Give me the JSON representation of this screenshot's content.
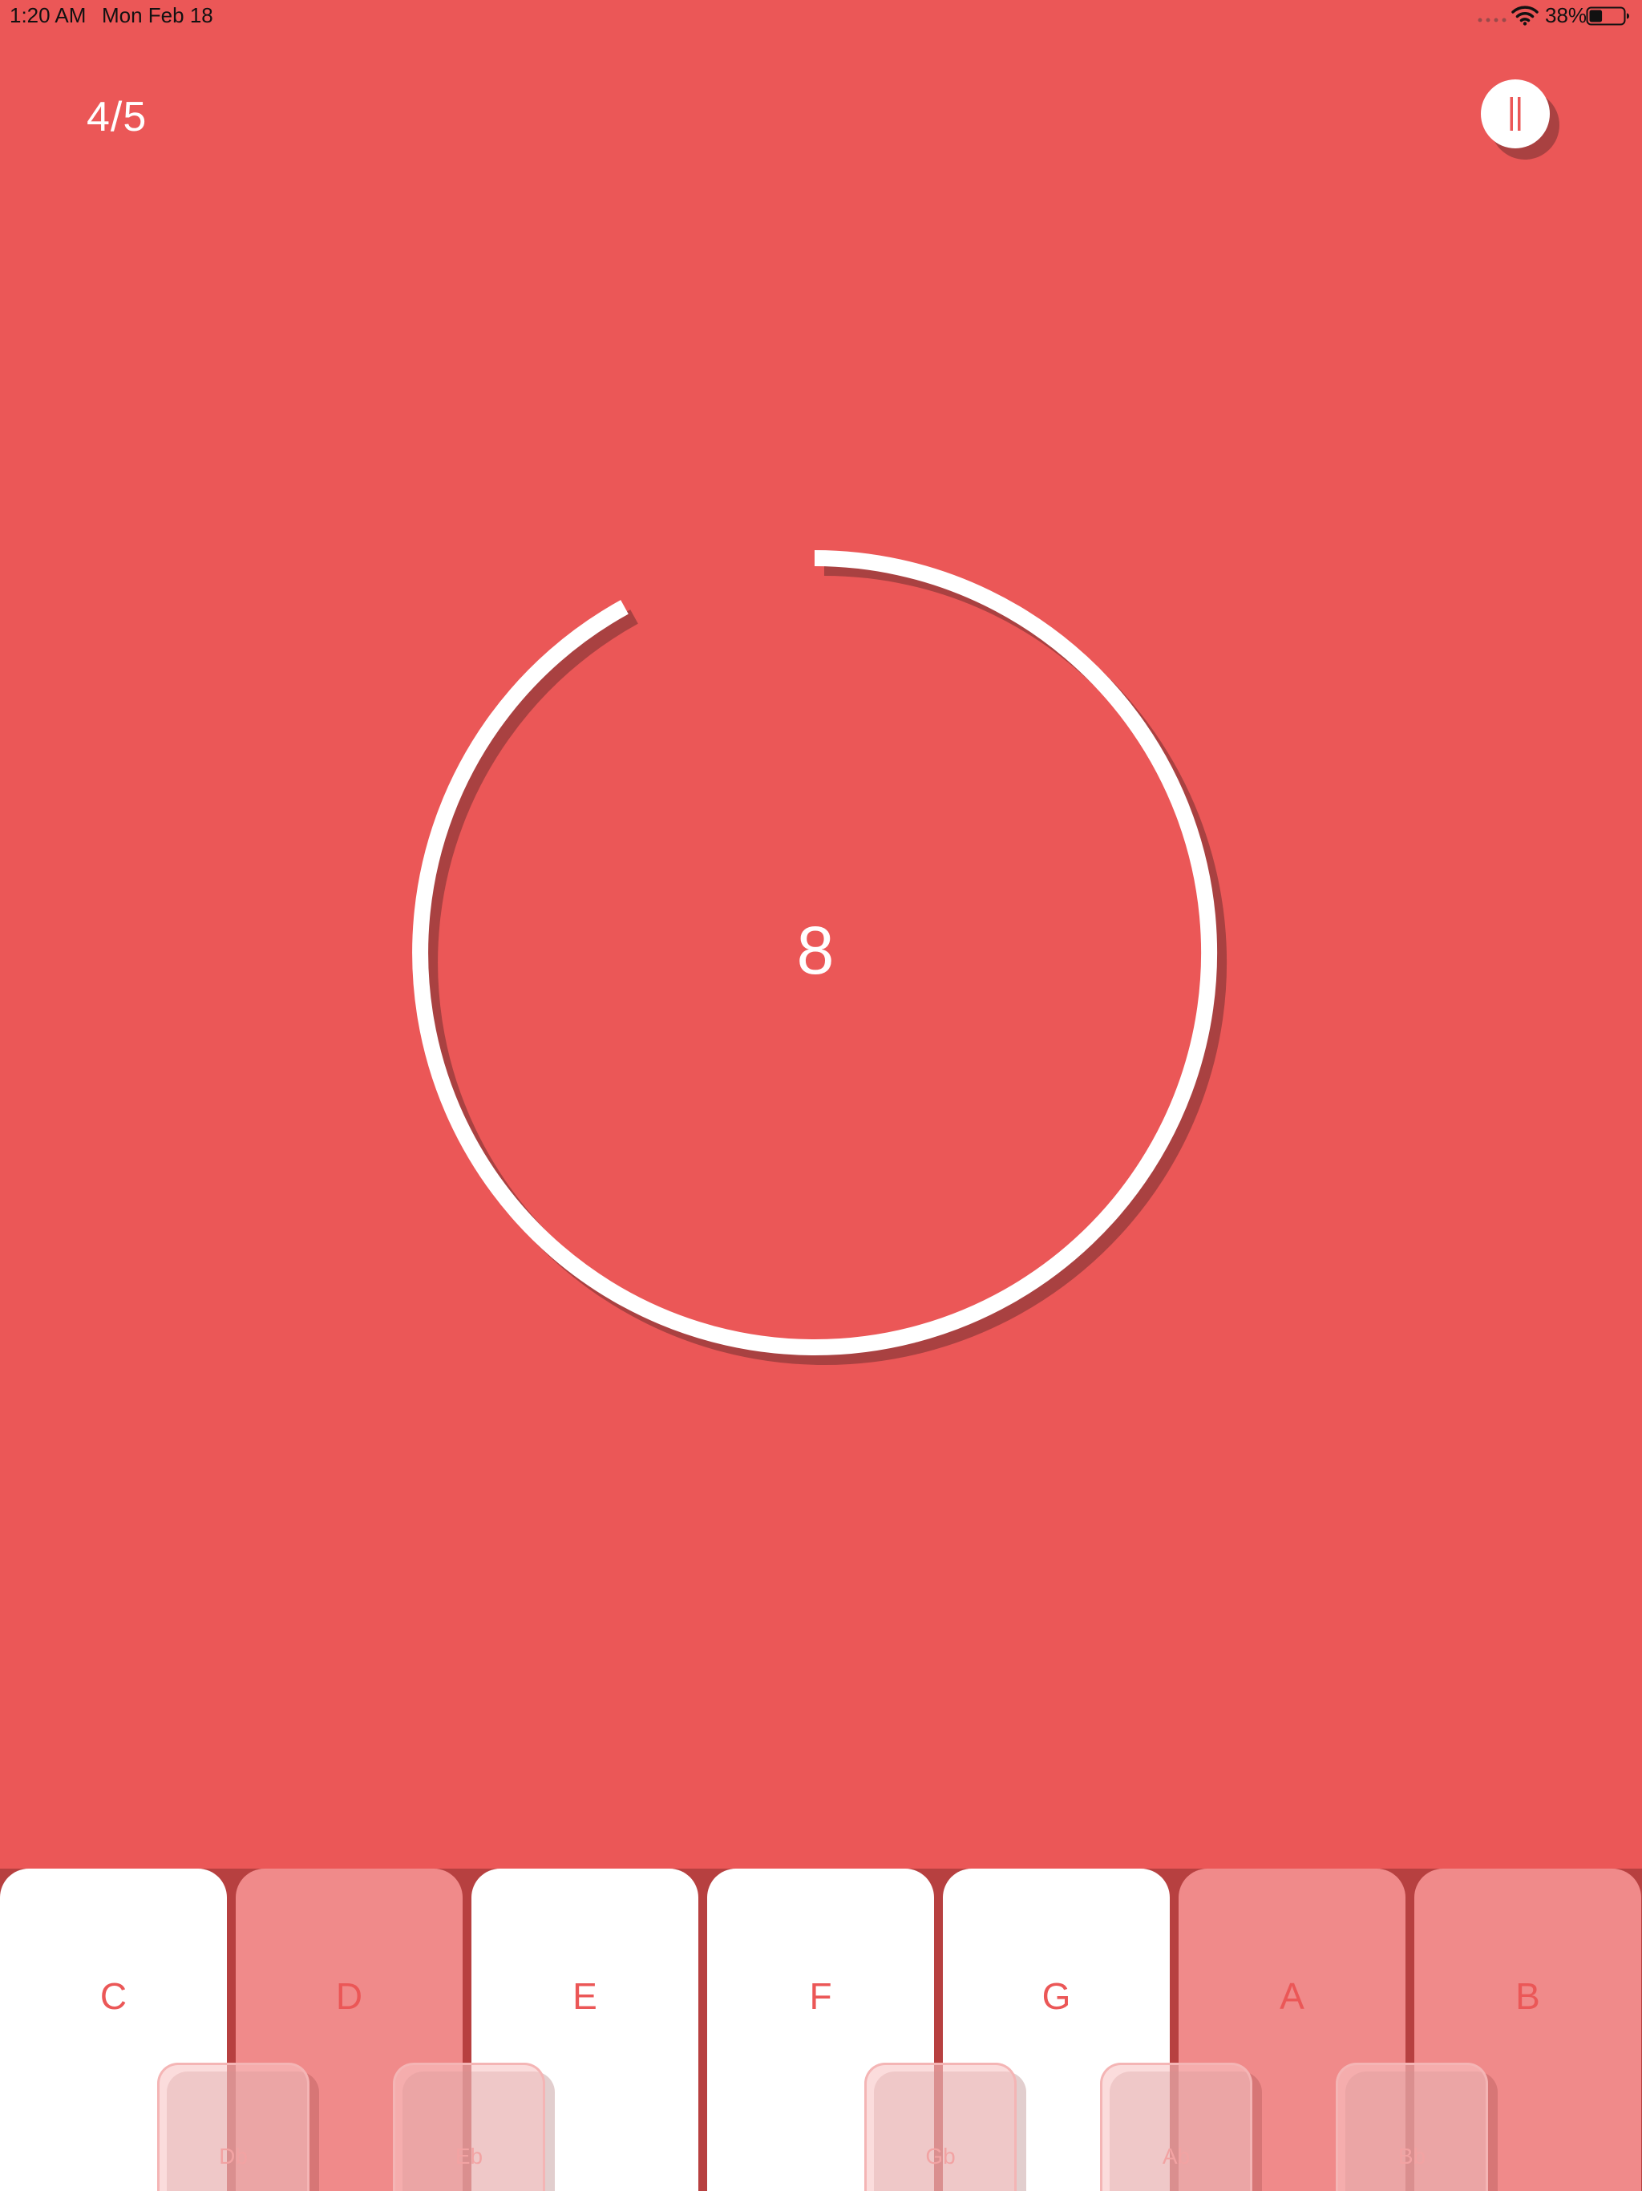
{
  "status_bar": {
    "time": "1:20 AM",
    "date": "Mon Feb 18",
    "battery_percent": "38%",
    "battery_level": 0.38,
    "icons": [
      "cellular-dots-icon",
      "wifi-icon",
      "battery-icon"
    ]
  },
  "game": {
    "progress": "4/5",
    "timer_value": "8",
    "ring_remaining_fraction": 0.92,
    "pause_icon": "pause-icon"
  },
  "piano": {
    "white_keys": [
      {
        "label": "C",
        "active": true
      },
      {
        "label": "D",
        "active": false
      },
      {
        "label": "E",
        "active": true
      },
      {
        "label": "F",
        "active": true
      },
      {
        "label": "G",
        "active": true
      },
      {
        "label": "A",
        "active": false
      },
      {
        "label": "B",
        "active": false
      }
    ],
    "black_keys": [
      {
        "label": "Db"
      },
      {
        "label": "Eb"
      },
      {
        "label": "Gb"
      },
      {
        "label": "Ab"
      },
      {
        "label": "Bb"
      }
    ]
  },
  "colors": {
    "background": "#EB5757",
    "accent_white": "#FFFFFF",
    "inactive_key": "#F08A8A",
    "shadow": "#A94141"
  }
}
